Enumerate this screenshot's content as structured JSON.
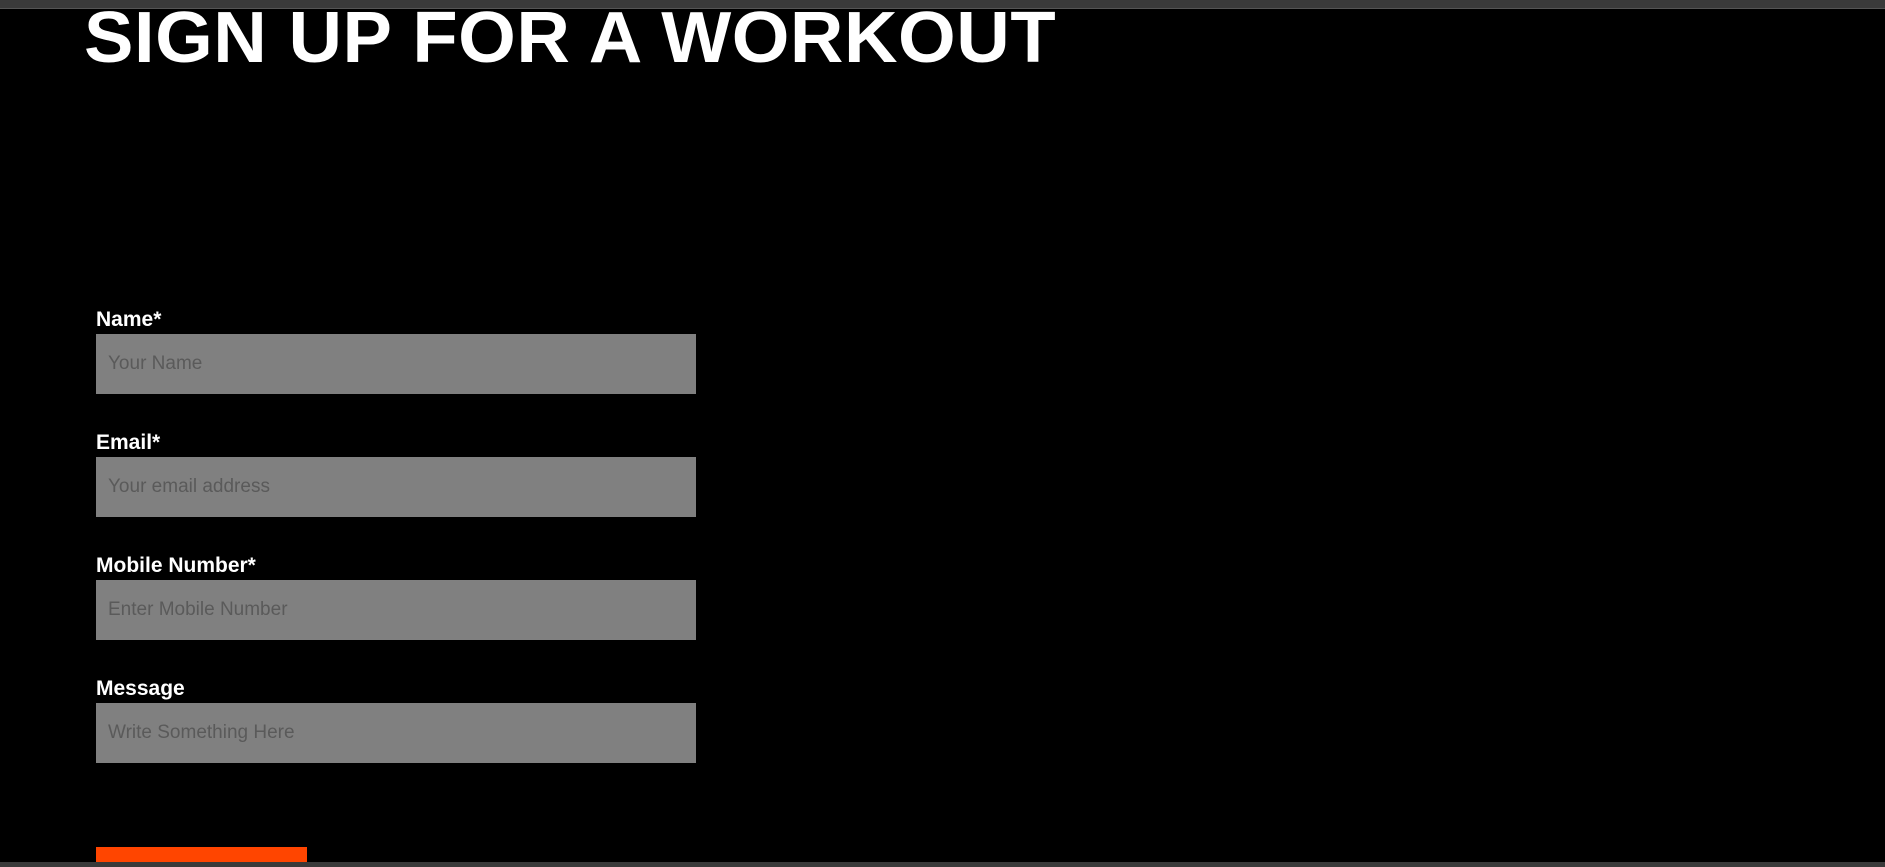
{
  "page": {
    "title": "SIGN UP FOR A WORKOUT"
  },
  "form": {
    "fields": [
      {
        "label": "Name*",
        "placeholder": "Your Name",
        "value": ""
      },
      {
        "label": "Email*",
        "placeholder": "Your email address",
        "value": ""
      },
      {
        "label": "Mobile Number*",
        "placeholder": "Enter Mobile Number",
        "value": ""
      },
      {
        "label": "Message",
        "placeholder": "Write Something Here",
        "value": ""
      }
    ],
    "submit": {
      "label": ""
    }
  },
  "colors": {
    "background": "#000000",
    "text": "#ffffff",
    "input_background": "#808080",
    "placeholder": "#5a5a5a",
    "accent": "#ff4500"
  }
}
